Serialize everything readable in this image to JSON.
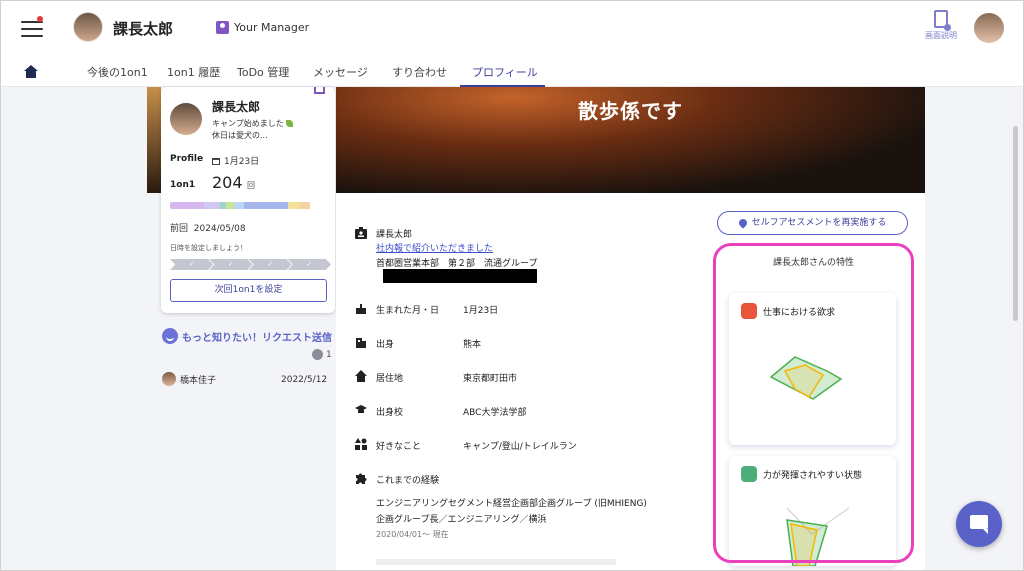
{
  "header": {
    "user_name": "課長太郎",
    "manager_label": "Your Manager",
    "help_label": "画面説明"
  },
  "tabs": [
    "今後の1on1",
    "1on1 履歴",
    "ToDo 管理",
    "メッセージ",
    "すり合わせ",
    "プロフィール"
  ],
  "active_tab": "プロフィール",
  "banner": {
    "title": "散歩係です"
  },
  "profile_card": {
    "name": "課長太郎",
    "status_line1": "キャンプ始めました",
    "status_line2": "休日は愛犬の...",
    "profile_label": "Profile",
    "birthday": "1月23日",
    "oneonone_label": "1on1",
    "oneonone_count": "204",
    "oneonone_unit": "回",
    "last_label": "前回",
    "last_date": "2024/05/08",
    "hint": "日時を設定しましょう！",
    "next_button": "次回1on1を設定",
    "bar_colors": [
      "#d6b8f0",
      "#cfc9f2",
      "#9fd5c8",
      "#c9e49a",
      "#b7d7f5",
      "#a8b6ee",
      "#f3e19a",
      "#f7d1a6"
    ]
  },
  "request": {
    "label": "もっと知りたい！リクエスト送信",
    "count": "1",
    "requester": "橋本佳子",
    "date": "2022/5/12"
  },
  "details": {
    "title_name": "課長太郎",
    "intro_link": "社内報で紹介いただきました",
    "department": "首都圏営業本部　第２部　流通グループ",
    "rows": [
      {
        "label": "生まれた月・日",
        "value": "1月23日",
        "icon": "cake-icon"
      },
      {
        "label": "出身",
        "value": "熊本",
        "icon": "building-icon"
      },
      {
        "label": "居住地",
        "value": "東京都町田市",
        "icon": "home-icon"
      },
      {
        "label": "出身校",
        "value": "ABC大学法学部",
        "icon": "school-icon"
      },
      {
        "label": "好きなこと",
        "value": "キャンプ/登山/トレイルラン",
        "icon": "category-icon"
      }
    ],
    "experience_label": "これまでの経験",
    "experience_line1": "エンジニアリングセグメント経営企画部企画グループ (旧MHIENG)",
    "experience_line2": "企画グループ長／エンジニアリング／横浜",
    "experience_date": "2020/04/01～ 現在"
  },
  "right": {
    "assess_button": "セルフアセスメントを再実施する",
    "traits_title": "課長太郎さんの特性",
    "card1_title": "仕事における欲求",
    "card2_title": "力が発揮されやすい状態",
    "colors": {
      "card1_icon": "#e8553a",
      "card2_icon": "#4caf7a",
      "radar_green": "#4caf50",
      "radar_orange": "#f5b800",
      "highlight": "#ea3fbf"
    }
  }
}
